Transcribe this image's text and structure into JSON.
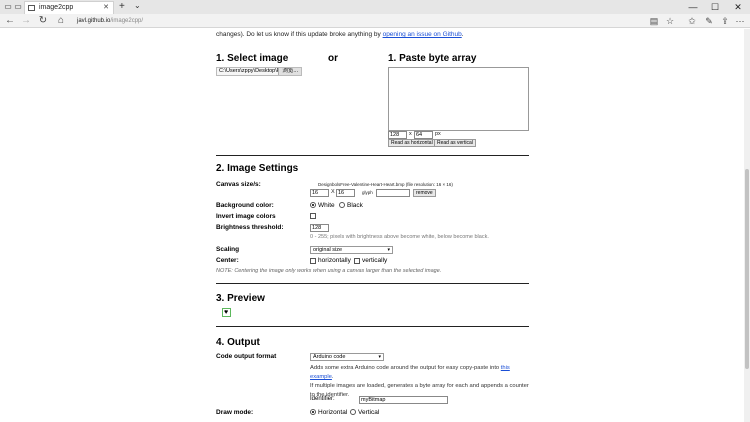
{
  "browser": {
    "tab_title": "image2cpp",
    "tab_close": "✕",
    "new_tab": "+",
    "tab_dropdown": "⌄",
    "address_host": "javl.github.io",
    "address_path": "/image2cpp/",
    "window": {
      "minimize": "—",
      "maximize": "☐",
      "close": "✕"
    },
    "icons": [
      "back-icon",
      "forward-icon",
      "refresh-icon",
      "home-icon",
      "reading-view-icon",
      "favorite-icon",
      "favorites-hub-icon",
      "notes-icon",
      "share-icon",
      "more-icon"
    ]
  },
  "intro": {
    "prefix": "changes). Do let us know if this update broke anything by ",
    "link": "opening an issue on Github",
    "suffix": "."
  },
  "section1": {
    "select_title": "1. Select image",
    "or": "or",
    "paste_title": "1. Paste byte array",
    "file_value": "C:\\Users\\zppy\\Desktop\\F",
    "browse_label": "浏览...",
    "width_value": "128",
    "x_label": "x",
    "height_value": "64",
    "px_label": "px",
    "read_horizontal": "Read as horizontal",
    "read_vertical": "Read as vertical"
  },
  "section2": {
    "title": "2. Image Settings",
    "canvas_label": "Canvas size/s:",
    "canvas_file": "DesignbolsFree-Valentine-Heart-Heart.bmp  (file resolution: 16 × 16)",
    "canvas_w": "16",
    "canvas_x": "X",
    "canvas_h": "16",
    "glyph_label": "glyph",
    "remove_label": "remove",
    "bg_label": "Background color:",
    "bg_white": "White",
    "bg_black": "Black",
    "invert_label": "Invert image colors",
    "brightness_label": "Brightness threshold:",
    "brightness_value": "128",
    "brightness_note": "0 - 255; pixels with brightness above become white, below become black.",
    "scaling_label": "Scaling",
    "scaling_value": "original size",
    "center_label": "Center:",
    "center_h": "horizontally",
    "center_v": "vertically",
    "center_note": "NOTE: Centering the image only works when using a canvas larger than the selected image."
  },
  "section3": {
    "title": "3. Preview"
  },
  "section4": {
    "title": "4. Output",
    "format_label": "Code output format",
    "format_value": "Arduino code",
    "desc1_prefix": "Adds some extra Arduino code around the output for easy copy-paste into ",
    "desc1_link": "this example",
    "desc1_suffix": ".",
    "desc2": "If multiple images are loaded, generates a byte array for each and appends a counter to the identifier.",
    "identifier_label": "Identifier:",
    "identifier_value": "myBitmap",
    "draw_label": "Draw mode:",
    "draw_horizontal": "Horizontal",
    "draw_vertical": "Vertical"
  },
  "colors": {
    "link": "#1a4fd6",
    "preview_border": "#5cb85c"
  }
}
